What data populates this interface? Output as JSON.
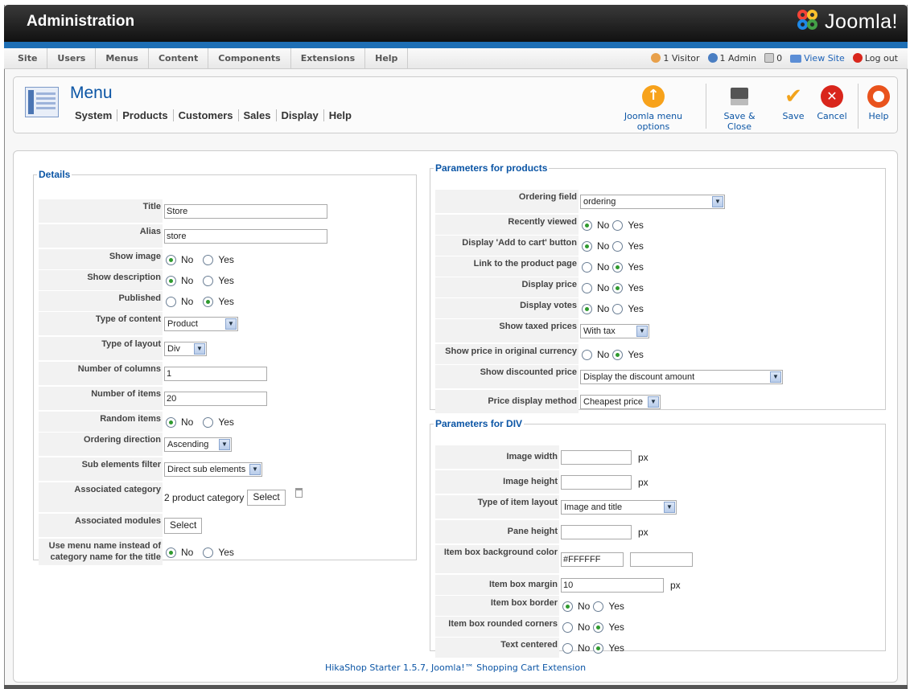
{
  "header": {
    "title": "Administration",
    "logo": "Joomla!"
  },
  "menubar": {
    "items": [
      "Site",
      "Users",
      "Menus",
      "Content",
      "Components",
      "Extensions",
      "Help"
    ],
    "visitors": "1 Visitor",
    "admins": "1 Admin",
    "messages": "0",
    "view_site": "View Site",
    "logout": "Log out"
  },
  "toolbar": {
    "title": "Menu",
    "subnav": [
      "System",
      "Products",
      "Customers",
      "Sales",
      "Display",
      "Help"
    ],
    "buttons": {
      "options": "Joomla menu options",
      "save_close": "Save & Close",
      "save": "Save",
      "cancel": "Cancel",
      "help": "Help"
    }
  },
  "details": {
    "legend": "Details",
    "title_label": "Title",
    "title_value": "Store",
    "alias_label": "Alias",
    "alias_value": "store",
    "show_image_label": "Show image",
    "show_description_label": "Show description",
    "published_label": "Published",
    "type_content_label": "Type of content",
    "type_content_value": "Product",
    "type_layout_label": "Type of layout",
    "type_layout_value": "Div",
    "num_columns_label": "Number of columns",
    "num_columns_value": "1",
    "num_items_label": "Number of items",
    "num_items_value": "20",
    "random_label": "Random items",
    "ordering_dir_label": "Ordering direction",
    "ordering_dir_value": "Ascending",
    "sub_filter_label": "Sub elements filter",
    "sub_filter_value": "Direct sub elements",
    "assoc_cat_label": "Associated category",
    "assoc_cat_value": "2 product category",
    "assoc_cat_button": "Select",
    "assoc_mod_label": "Associated modules",
    "assoc_mod_button": "Select",
    "use_menu_name_label_1": "Use menu name instead of",
    "use_menu_name_label_2": "category name for the title"
  },
  "radio": {
    "no": "No",
    "yes": "Yes"
  },
  "products": {
    "legend": "Parameters for products",
    "ordering_field_label": "Ordering field",
    "ordering_field_value": "ordering",
    "recently_viewed_label": "Recently viewed",
    "add_to_cart_label": "Display 'Add to cart' button",
    "link_product_label": "Link to the product page",
    "display_price_label": "Display price",
    "display_votes_label": "Display votes",
    "taxed_prices_label": "Show taxed prices",
    "taxed_prices_value": "With tax",
    "orig_currency_label": "Show price in original currency",
    "discounted_label": "Show discounted price",
    "discounted_value": "Display the discount amount",
    "price_method_label": "Price display method",
    "price_method_value": "Cheapest price"
  },
  "div": {
    "legend": "Parameters for DIV",
    "image_width_label": "Image width",
    "image_height_label": "Image height",
    "item_layout_label": "Type of item layout",
    "item_layout_value": "Image and title",
    "pane_height_label": "Pane height",
    "bg_color_label": "Item box background color",
    "bg_color_value": "#FFFFFF",
    "margin_label": "Item box margin",
    "margin_value": "10",
    "border_label": "Item box border",
    "rounded_label": "Item box rounded corners",
    "centered_label": "Text centered",
    "px": "px"
  },
  "footer": "HikaShop Starter 1.5.7, Joomla!™ Shopping Cart Extension"
}
